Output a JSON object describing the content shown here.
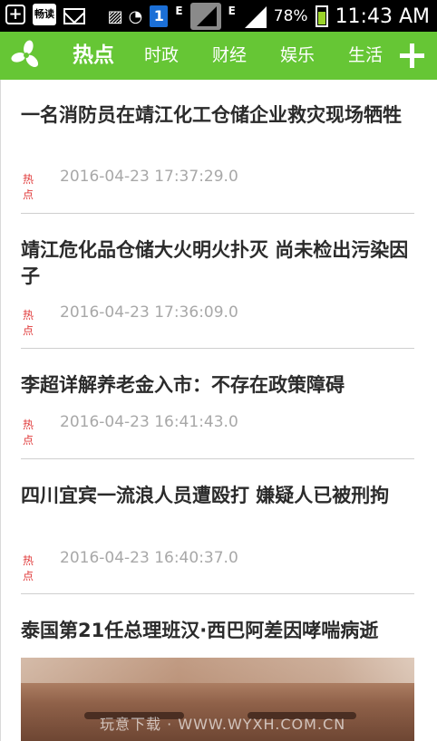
{
  "status_bar": {
    "app_badge": "畅读",
    "notification_count": "1",
    "network_type_1": "E",
    "network_type_2": "E",
    "battery": "78%",
    "time": "11:43 AM"
  },
  "nav": {
    "tabs": [
      "热点",
      "时政",
      "财经",
      "娱乐",
      "生活"
    ],
    "active_tab": "热点",
    "colors": {
      "bar": "#66c635",
      "tag": "#e03b3b"
    }
  },
  "articles": [
    {
      "title": "一名消防员在靖江化工仓储企业救灾现场牺牲",
      "tag": "热点",
      "time": "2016-04-23 17:37:29.0"
    },
    {
      "title": "靖江危化品仓储大火明火扑灭 尚未检出污染因子",
      "tag": "热点",
      "time": "2016-04-23 17:36:09.0"
    },
    {
      "title": "李超详解养老金入市：不存在政策障碍",
      "tag": "热点",
      "time": "2016-04-23 16:41:43.0"
    },
    {
      "title": "四川宜宾一流浪人员遭殴打 嫌疑人已被刑拘",
      "tag": "热点",
      "time": "2016-04-23 16:40:37.0"
    },
    {
      "title": "泰国第21任总理班汉·西巴阿差因哮喘病逝"
    }
  ],
  "watermark": "玩意下载 · WWW.WYXH.COM.CN"
}
